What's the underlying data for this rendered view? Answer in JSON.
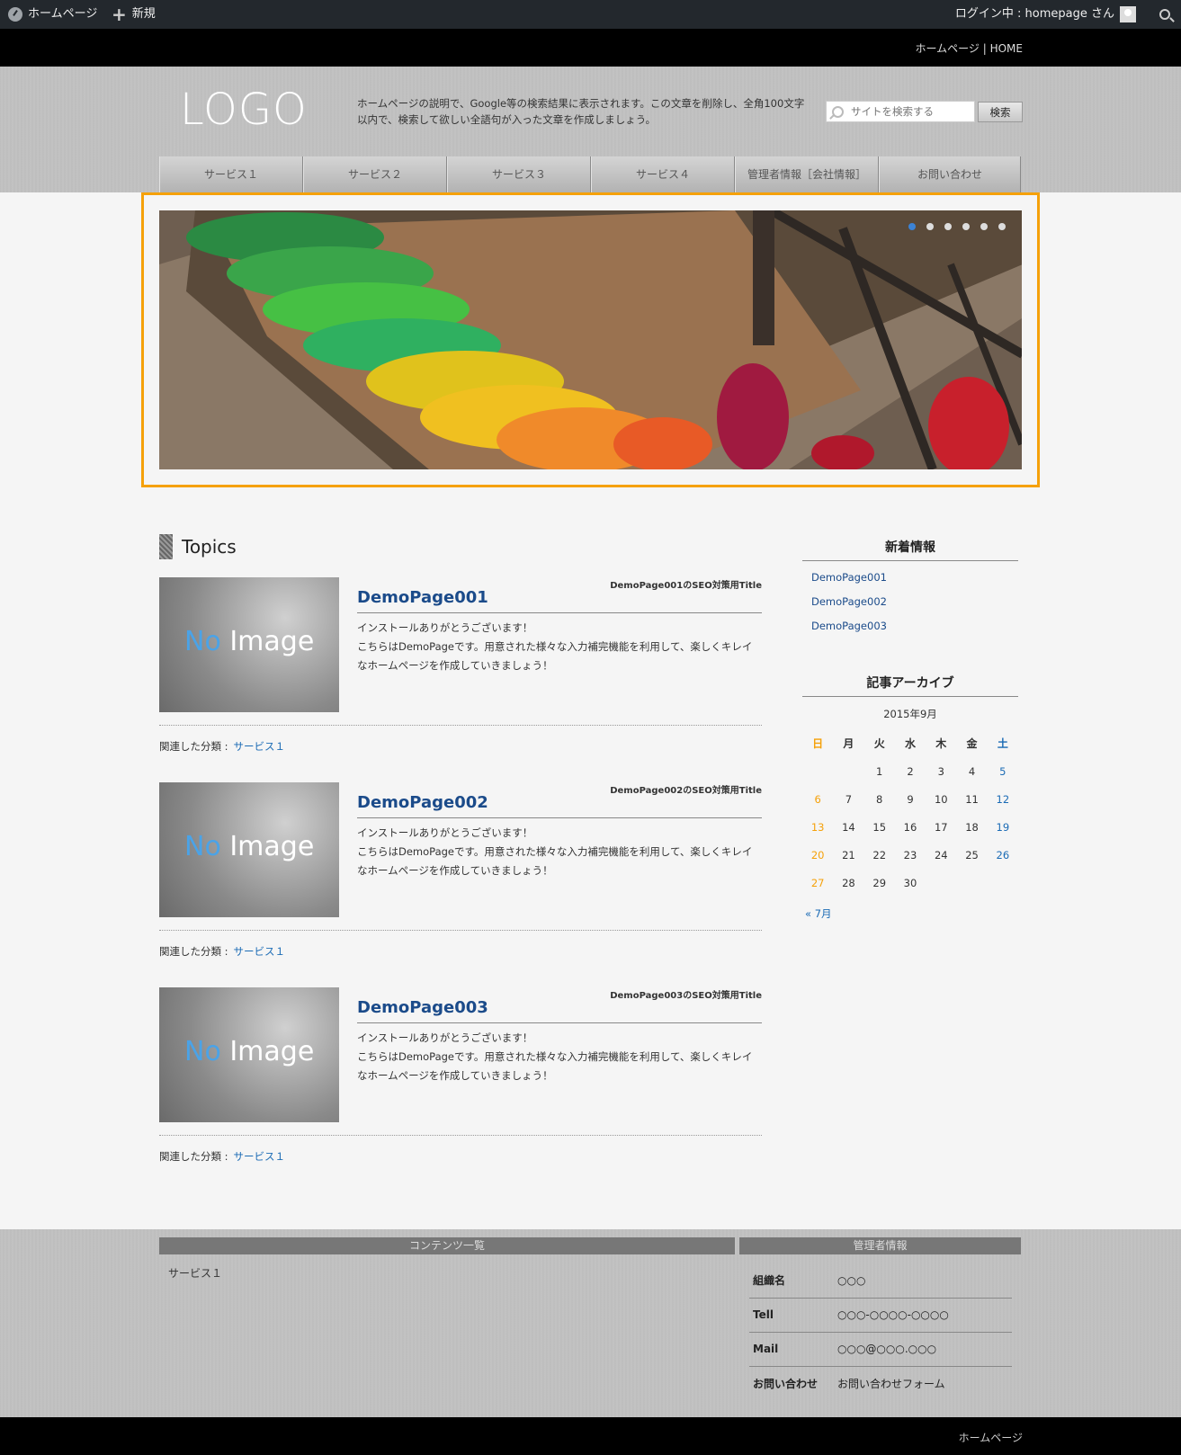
{
  "adminbar": {
    "home_label": "ホームページ",
    "new_label": "新規",
    "login_label": "ログイン中 : homepage さん"
  },
  "topstrip": {
    "tagline": "ホームページ | HOME"
  },
  "header": {
    "logo": "LOGO",
    "description": "ホームページの説明で、Google等の検索結果に表示されます。この文章を削除し、全角100文字以内で、検索して欲しい全語句が入った文章を作成しましょう。",
    "search_placeholder": "サイトを検索する",
    "search_button": "検索"
  },
  "nav": [
    "サービス１",
    "サービス２",
    "サービス３",
    "サービス４",
    "管理者情報［会社情報］",
    "お問い合わせ"
  ],
  "slider": {
    "dot_count": 6,
    "active_index": 0
  },
  "topics": {
    "heading": "Topics",
    "posts": [
      {
        "seo_title": "DemoPage001のSEO対策用Title",
        "title": "DemoPage001",
        "line1": "インストールありがとうございます！",
        "line2": "こちらはDemoPageです。用意された様々な入力補完機能を利用して、楽しくキレイなホームページを作成していきましょう！",
        "category_label": "関連した分類 :",
        "category": "サービス１",
        "thumb_text_no": "No",
        "thumb_text_image": " Image"
      },
      {
        "seo_title": "DemoPage002のSEO対策用Title",
        "title": "DemoPage002",
        "line1": "インストールありがとうございます！",
        "line2": "こちらはDemoPageです。用意された様々な入力補完機能を利用して、楽しくキレイなホームページを作成していきましょう！",
        "category_label": "関連した分類 :",
        "category": "サービス１",
        "thumb_text_no": "No",
        "thumb_text_image": " Image"
      },
      {
        "seo_title": "DemoPage003のSEO対策用Title",
        "title": "DemoPage003",
        "line1": "インストールありがとうございます！",
        "line2": "こちらはDemoPageです。用意された様々な入力補完機能を利用して、楽しくキレイなホームページを作成していきましょう！",
        "category_label": "関連した分類 :",
        "category": "サービス１",
        "thumb_text_no": "No",
        "thumb_text_image": " Image"
      }
    ]
  },
  "sidebar": {
    "new_title": "新着情報",
    "new_items": [
      "DemoPage001",
      "DemoPage002",
      "DemoPage003"
    ],
    "archive_title": "記事アーカイブ",
    "calendar": {
      "caption": "2015年9月",
      "weekdays": [
        "日",
        "月",
        "火",
        "水",
        "木",
        "金",
        "土"
      ],
      "weeks": [
        [
          "",
          "",
          "1",
          "2",
          "3",
          "4",
          "5"
        ],
        [
          "6",
          "7",
          "8",
          "9",
          "10",
          "11",
          "12"
        ],
        [
          "13",
          "14",
          "15",
          "16",
          "17",
          "18",
          "19"
        ],
        [
          "20",
          "21",
          "22",
          "23",
          "24",
          "25",
          "26"
        ],
        [
          "27",
          "28",
          "29",
          "30",
          "",
          "",
          ""
        ]
      ],
      "prev": "« 7月",
      "sun_color": "#f5a10a",
      "sat_color": "#1b6bb5"
    }
  },
  "footer": {
    "content_head": "コンテンツ一覧",
    "admin_head": "管理者情報",
    "content_items": [
      "サービス１"
    ],
    "admin_rows": [
      {
        "key": "組織名",
        "value": "○○○"
      },
      {
        "key": "Tell",
        "value": "○○○-○○○○-○○○○"
      },
      {
        "key": "Mail",
        "value": "○○○@○○○.○○○"
      },
      {
        "key": "お問い合わせ",
        "value": "お問い合わせフォーム"
      }
    ]
  },
  "bottombar": {
    "text": "ホームページ"
  },
  "colors": {
    "accent": "#f5a10a",
    "link": "#1b6bb5",
    "title": "#1b4b8a"
  }
}
